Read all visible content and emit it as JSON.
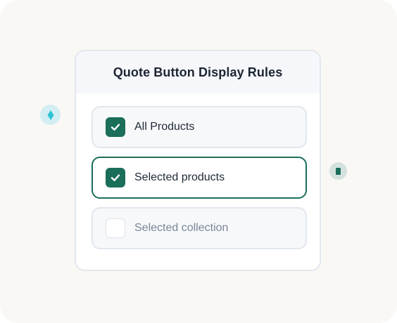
{
  "panel": {
    "title": "Quote Button Display Rules"
  },
  "options": [
    {
      "label": "All Products",
      "checked": true
    },
    {
      "label": "Selected products",
      "checked": true,
      "highlighted": true
    },
    {
      "label": "Selected collection",
      "checked": false
    }
  ],
  "colors": {
    "accent": "#1a6e5a",
    "card_border": "#e3e7ee",
    "header_bg": "#f5f7fa",
    "background": "#f9f8f5",
    "left_connector": "#d3eef2",
    "right_connector": "#d4e2dd"
  },
  "icons": {
    "left_connector": "diamond-icon",
    "right_connector": "square-icon",
    "checkmark": "check-icon"
  }
}
